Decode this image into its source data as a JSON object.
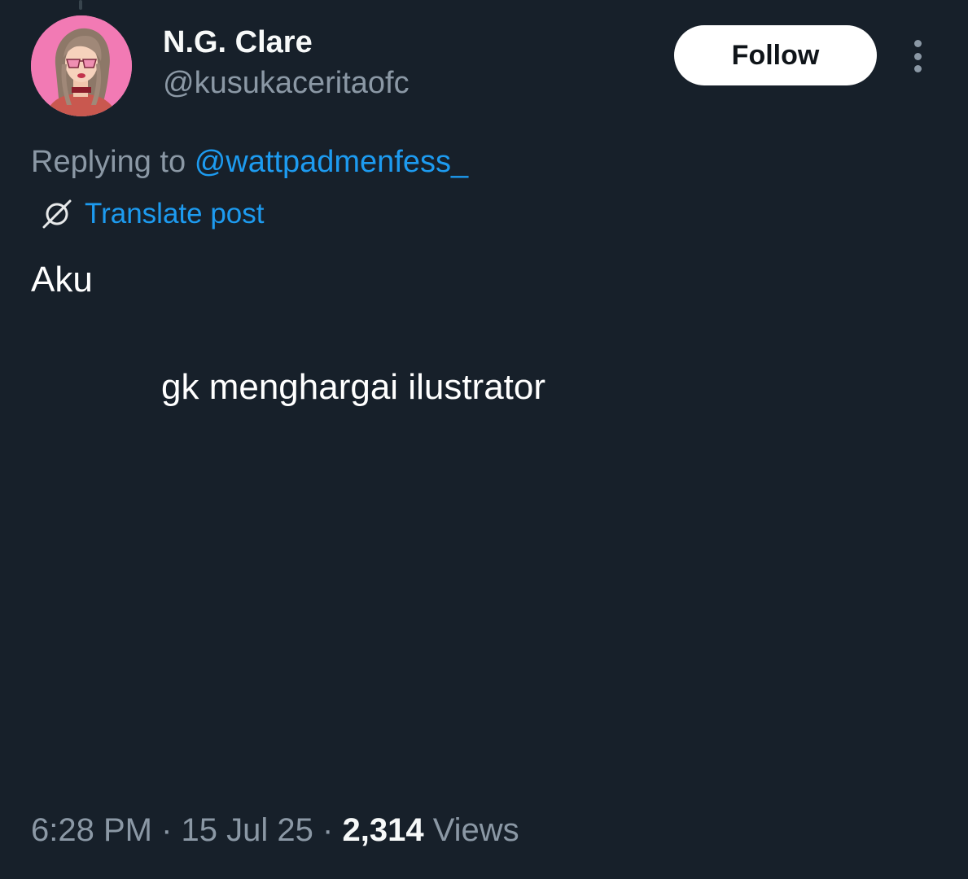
{
  "author": {
    "display_name": "N.G. Clare",
    "handle": "@kusukaceritaofc",
    "avatar_icon": "avatar-illustration-girl-sunglasses"
  },
  "actions": {
    "follow_label": "Follow",
    "more_icon": "more-options-icon"
  },
  "reply": {
    "prefix": "Replying to",
    "mention": "@wattpadmenfess_"
  },
  "translate": {
    "icon": "translate-icon",
    "label": "Translate post"
  },
  "post": {
    "line1": "Aku",
    "line2": "gk menghargai ilustrator"
  },
  "meta": {
    "time": "6:28 PM",
    "separator": "·",
    "date": "15 Jul 25",
    "views_count": "2,314",
    "views_label": "Views"
  },
  "colors": {
    "background": "#17202a",
    "text_primary": "#ffffff",
    "text_secondary": "#8b98a5",
    "link": "#1d9bf0",
    "follow_button_bg": "#ffffff",
    "avatar_bg": "#f27ab4"
  }
}
